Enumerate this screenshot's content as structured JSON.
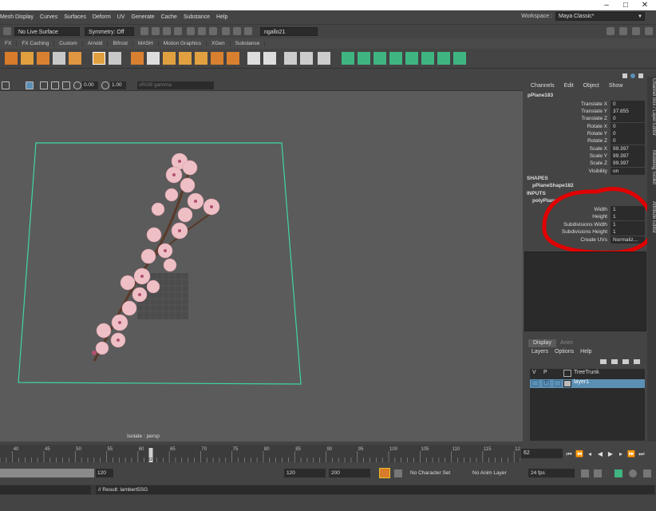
{
  "window": {
    "controls": [
      "–",
      "□",
      "✕"
    ]
  },
  "menubar": {
    "items": [
      "Mesh Display",
      "Curves",
      "Surfaces",
      "Deform",
      "UV",
      "Generate",
      "Cache",
      "Substance",
      "Help"
    ],
    "workspace_label": "Workspace :",
    "workspace_value": "Maya Classic*"
  },
  "statusline": {
    "live_surface": "No Live Surface",
    "symmetry": "Symmetry: Off",
    "user": "ngallo21"
  },
  "shelf_tabs": [
    "FX",
    "FX Caching",
    "Custom",
    "Arnold",
    "Bifrost",
    "MASH",
    "Motion Graphics",
    "XGen",
    "Substance"
  ],
  "viewport_toolbar": {
    "value1": "0.00",
    "value2": "1.00",
    "color_space": "sRGB gamma"
  },
  "viewport": {
    "isolate_label": "Isolate : persp"
  },
  "channel_box": {
    "menu": [
      "Channels",
      "Edit",
      "Object",
      "Show"
    ],
    "object_name": "pPlane183",
    "attributes": [
      {
        "label": "Translate X",
        "value": "0"
      },
      {
        "label": "Translate Y",
        "value": "37.855"
      },
      {
        "label": "Translate Z",
        "value": "0"
      },
      {
        "label": "Rotate X",
        "value": "0"
      },
      {
        "label": "Rotate Y",
        "value": "0"
      },
      {
        "label": "Rotate Z",
        "value": "0"
      },
      {
        "label": "Scale X",
        "value": "99.397"
      },
      {
        "label": "Scale Y",
        "value": "99.397"
      },
      {
        "label": "Scale Z",
        "value": "99.397"
      },
      {
        "label": "Visibility",
        "value": "on"
      }
    ],
    "shapes_header": "SHAPES",
    "shape_name": "pPlaneShape182",
    "inputs_header": "INPUTS",
    "input_name": "polyPlane3",
    "input_attributes": [
      {
        "label": "Width",
        "value": "1"
      },
      {
        "label": "Height",
        "value": "1"
      },
      {
        "label": "Subdivisions Width",
        "value": "1"
      },
      {
        "label": "Subdivisions Height",
        "value": "1"
      },
      {
        "label": "Create UVs",
        "value": "Normaliz..."
      }
    ]
  },
  "side_tabs": [
    "Channel Box / Layer Editor",
    "Modeling Toolkit",
    "Attribute Editor"
  ],
  "layer_editor": {
    "tabs": [
      "Display",
      "Anim"
    ],
    "menu": [
      "Layers",
      "Options",
      "Help"
    ],
    "col_v": "V",
    "col_p": "P",
    "layers": [
      {
        "name": "TreeTrunk",
        "selected": false
      },
      {
        "name": "layer1",
        "p": "P",
        "selected": true
      }
    ]
  },
  "timeslider": {
    "ticks": [
      {
        "label": "40",
        "value": 40
      },
      {
        "label": "45",
        "value": 45
      },
      {
        "label": "50",
        "value": 50
      },
      {
        "label": "55",
        "value": 55
      },
      {
        "label": "60",
        "value": 60
      },
      {
        "label": "65",
        "value": 65
      },
      {
        "label": "70",
        "value": 70
      },
      {
        "label": "75",
        "value": 75
      },
      {
        "label": "80",
        "value": 80
      },
      {
        "label": "85",
        "value": 85
      },
      {
        "label": "90",
        "value": 90
      },
      {
        "label": "95",
        "value": 95
      },
      {
        "label": "100",
        "value": 100
      },
      {
        "label": "105",
        "value": 105
      },
      {
        "label": "110",
        "value": 110
      },
      {
        "label": "115",
        "value": 115
      },
      {
        "label": "120",
        "value": 120
      }
    ],
    "current_frame": "62",
    "current_frame_value": 62,
    "current_frame_field": "62"
  },
  "range": {
    "start_field": "120",
    "end_playback": "120",
    "end_animation": "200",
    "character_set": "No Character Set",
    "anim_layer": "No Anim Layer",
    "fps": "24 fps"
  },
  "command": {
    "result": "// Result: lambert5SG"
  },
  "colors": {
    "accent_blue": "#5b8fb4",
    "annotation_red": "#e00000",
    "plane_outline": "#3fd5a8"
  }
}
